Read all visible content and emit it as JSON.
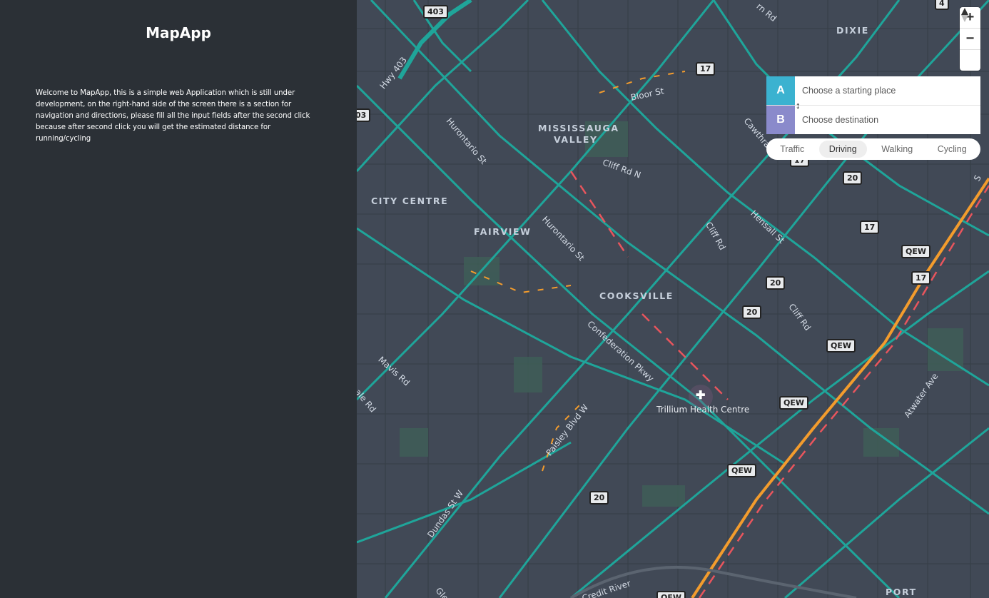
{
  "sidebar": {
    "title": "MapApp",
    "welcome_text": "Welcome to MapApp, this is a simple web Application which is still under development, on the right-hand side of the screen there is a section for navigation and directions, please fill all the input fields after the second click because after second click you will get the estimated distance for running/cycling"
  },
  "directions": {
    "origin_letter": "A",
    "origin_placeholder": "Choose a starting place",
    "destination_letter": "B",
    "destination_placeholder": "Choose destination",
    "swap_icon": "↕",
    "origin_color": "#3bb2d0",
    "destination_color": "#8a8acb",
    "profiles": [
      "Traffic",
      "Driving",
      "Walking",
      "Cycling"
    ],
    "active_profile": "Driving"
  },
  "controls": {
    "zoom_in": "+",
    "zoom_out": "−"
  },
  "map": {
    "places": [
      "DIXIE",
      "MISSISSAUGA",
      "VALLEY",
      "CITY CENTRE",
      "FAIRVIEW",
      "COOKSVILLE",
      "PORT"
    ],
    "streets": [
      "Hwy 403",
      "Hurontario St",
      "Hurontario St",
      "Bloor St",
      "Cliff Rd N",
      "Cliff Rd",
      "Hensall St",
      "Cliff Rd",
      "Confederation Pkwy",
      "Mavis Rd",
      "Paisley Blvd W",
      "Dundas St W",
      "Atwater Ave",
      "Credit River",
      "Cawthra Rd",
      "Glenn",
      "ale Rd",
      "rn Rd",
      "S"
    ],
    "shields": [
      "403",
      "4",
      "17",
      "03",
      "17",
      "20",
      "17",
      "QEW",
      "17",
      "20",
      "20",
      "QEW",
      "QEW",
      "QEW",
      "20",
      "QEW"
    ],
    "poi": "Trillium Health Centre"
  },
  "colors": {
    "sidebar_bg": "#2b3036",
    "map_bg": "#414956",
    "road_teal": "#1fa59a",
    "road_orange": "#f39c2d",
    "road_red": "#e8555d"
  }
}
